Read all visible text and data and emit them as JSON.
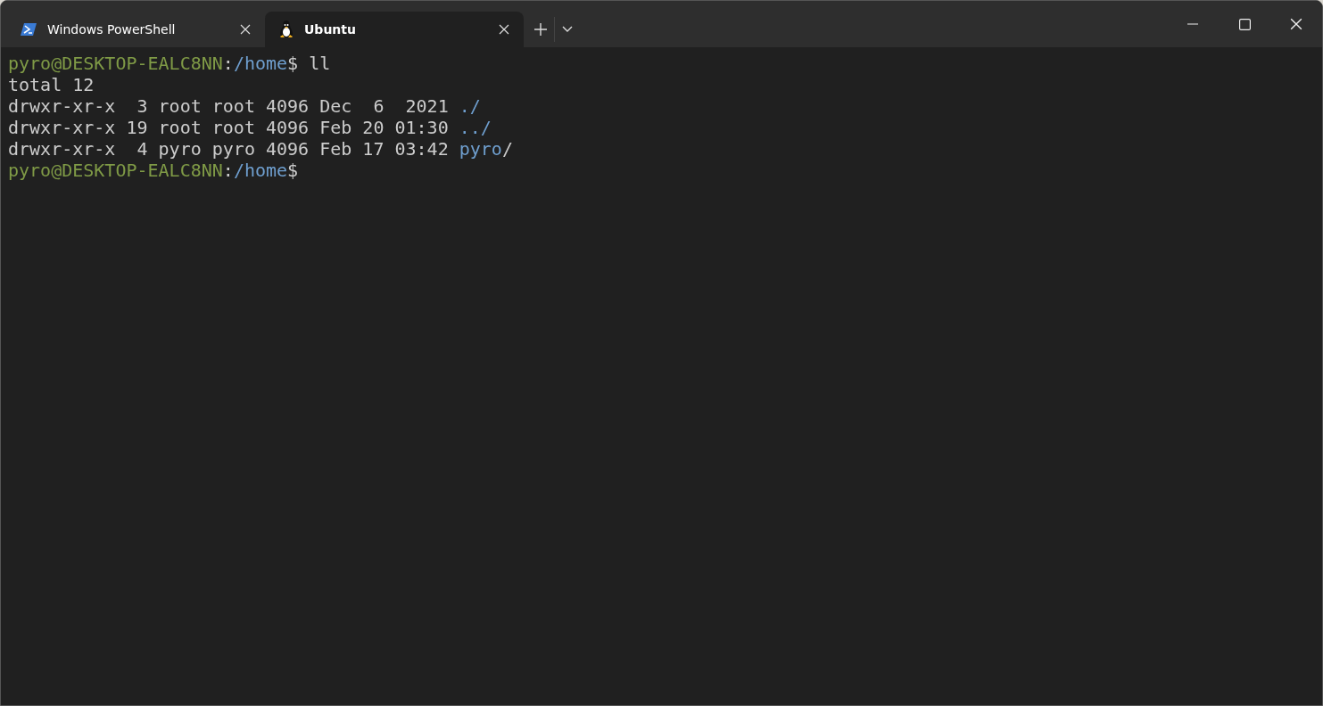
{
  "tabs": [
    {
      "title": "Windows PowerShell",
      "kind": "powershell",
      "selected": false
    },
    {
      "title": "Ubuntu",
      "kind": "linux",
      "selected": true
    }
  ],
  "terminal": {
    "lines": [
      [
        {
          "text": "pyro@DESKTOP-EALC8NN",
          "kind": "user"
        },
        {
          "text": ":",
          "kind": "plain"
        },
        {
          "text": "/home",
          "kind": "path"
        },
        {
          "text": "$ ll",
          "kind": "plain"
        }
      ],
      [
        {
          "text": "total 12",
          "kind": "plain"
        }
      ],
      [
        {
          "text": "drwxr-xr-x  3 root root 4096 Dec  6  2021 ",
          "kind": "plain"
        },
        {
          "text": "./",
          "kind": "path"
        }
      ],
      [
        {
          "text": "drwxr-xr-x 19 root root 4096 Feb 20 01:30 ",
          "kind": "plain"
        },
        {
          "text": "../",
          "kind": "path"
        }
      ],
      [
        {
          "text": "drwxr-xr-x  4 pyro pyro 4096 Feb 17 03:42 ",
          "kind": "plain"
        },
        {
          "text": "pyro",
          "kind": "path"
        },
        {
          "text": "/",
          "kind": "plain"
        }
      ],
      [
        {
          "text": "pyro@DESKTOP-EALC8NN",
          "kind": "user"
        },
        {
          "text": ":",
          "kind": "plain"
        },
        {
          "text": "/home",
          "kind": "path"
        },
        {
          "text": "$",
          "kind": "plain"
        }
      ]
    ]
  }
}
